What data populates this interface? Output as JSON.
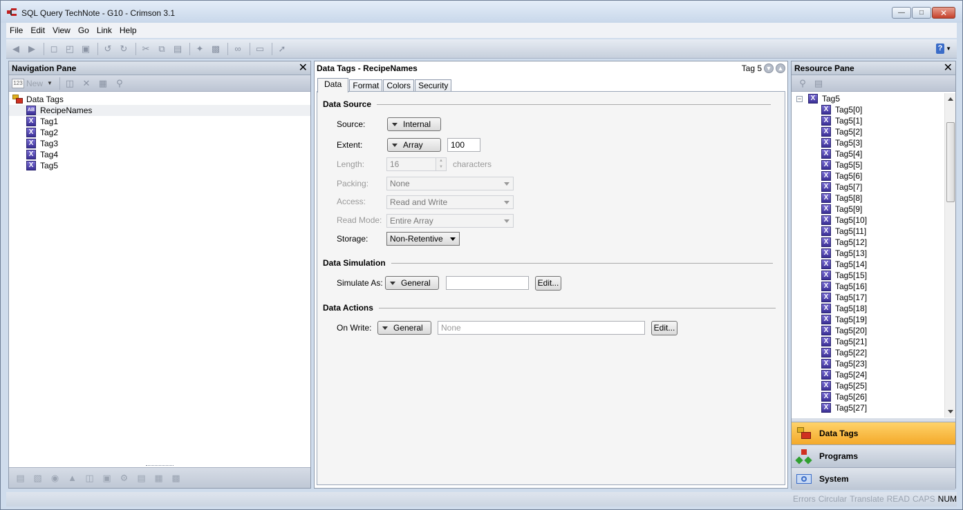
{
  "window": {
    "title": "SQL Query TechNote - G10 - Crimson 3.1"
  },
  "menu": [
    "File",
    "Edit",
    "View",
    "Go",
    "Link",
    "Help"
  ],
  "nav_pane": {
    "title": "Navigation Pane",
    "new_label": "New",
    "tree": {
      "root": "Data Tags",
      "items": [
        {
          "label": "RecipeNames",
          "icon": "string-tag-icon",
          "selected": true
        },
        {
          "label": "Tag1",
          "icon": "tag-icon"
        },
        {
          "label": "Tag2",
          "icon": "tag-icon"
        },
        {
          "label": "Tag3",
          "icon": "tag-icon"
        },
        {
          "label": "Tag4",
          "icon": "tag-icon"
        },
        {
          "label": "Tag5",
          "icon": "tag-icon"
        }
      ]
    }
  },
  "editor": {
    "title": "Data Tags - RecipeNames",
    "current_tag": "Tag 5",
    "tabs": [
      "Data",
      "Format",
      "Colors",
      "Security"
    ],
    "active_tab": "Data",
    "data_source": {
      "heading": "Data Source",
      "source_label": "Source:",
      "source_value": "Internal",
      "extent_label": "Extent:",
      "extent_value": "Array",
      "extent_count": "100",
      "length_label": "Length:",
      "length_value": "16",
      "length_units": "characters",
      "packing_label": "Packing:",
      "packing_value": "None",
      "access_label": "Access:",
      "access_value": "Read and Write",
      "readmode_label": "Read Mode:",
      "readmode_value": "Entire Array",
      "storage_label": "Storage:",
      "storage_value": "Non-Retentive"
    },
    "data_simulation": {
      "heading": "Data Simulation",
      "simulate_label": "Simulate As:",
      "simulate_mode": "General",
      "simulate_value": "",
      "edit_label": "Edit..."
    },
    "data_actions": {
      "heading": "Data Actions",
      "onwrite_label": "On Write:",
      "onwrite_mode": "General",
      "onwrite_placeholder": "None",
      "edit_label": "Edit..."
    }
  },
  "resource_pane": {
    "title": "Resource Pane",
    "root": "Tag5",
    "items": [
      "Tag5[0]",
      "Tag5[1]",
      "Tag5[2]",
      "Tag5[3]",
      "Tag5[4]",
      "Tag5[5]",
      "Tag5[6]",
      "Tag5[7]",
      "Tag5[8]",
      "Tag5[9]",
      "Tag5[10]",
      "Tag5[11]",
      "Tag5[12]",
      "Tag5[13]",
      "Tag5[14]",
      "Tag5[15]",
      "Tag5[16]",
      "Tag5[17]",
      "Tag5[18]",
      "Tag5[19]",
      "Tag5[20]",
      "Tag5[21]",
      "Tag5[22]",
      "Tag5[23]",
      "Tag5[24]",
      "Tag5[25]",
      "Tag5[26]",
      "Tag5[27]"
    ],
    "categories": [
      {
        "label": "Data Tags",
        "active": true
      },
      {
        "label": "Programs",
        "active": false
      },
      {
        "label": "System",
        "active": false
      }
    ]
  },
  "status": {
    "indicators": [
      {
        "label": "Errors",
        "on": false
      },
      {
        "label": "Circular",
        "on": false
      },
      {
        "label": "Translate",
        "on": false
      },
      {
        "label": "READ",
        "on": false
      },
      {
        "label": "CAPS",
        "on": false
      },
      {
        "label": "NUM",
        "on": true
      }
    ]
  },
  "colors": {
    "accent_active": "#f4a92a",
    "tag_icon": "#3a2f95"
  }
}
